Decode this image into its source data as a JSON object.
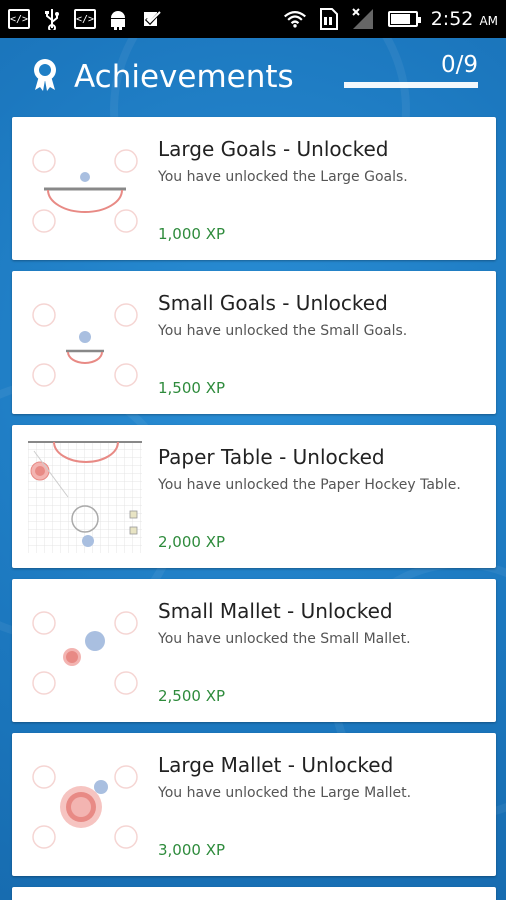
{
  "status_bar": {
    "time": "2:52",
    "ampm": "AM",
    "left_icons": [
      "code-icon",
      "usb-icon",
      "code-icon",
      "android-icon",
      "check-icon"
    ],
    "right_icons": [
      "wifi-icon",
      "sim-icon",
      "signal-icon",
      "battery-icon"
    ]
  },
  "header": {
    "title": "Achievements",
    "icon": "ribbon-icon",
    "progress": "0/9",
    "progress_fraction": 0
  },
  "achievements": [
    {
      "title": "Large Goals - Unlocked",
      "description": "You have unlocked the Large Goals.",
      "xp": "1,000 XP",
      "thumb": "large-goals"
    },
    {
      "title": "Small Goals - Unlocked",
      "description": "You have unlocked the Small Goals.",
      "xp": "1,500 XP",
      "thumb": "small-goals"
    },
    {
      "title": "Paper Table - Unlocked",
      "description": "You have unlocked the Paper Hockey Table.",
      "xp": "2,000 XP",
      "thumb": "paper-table"
    },
    {
      "title": "Small Mallet - Unlocked",
      "description": "You have unlocked the Small Mallet.",
      "xp": "2,500 XP",
      "thumb": "small-mallet"
    },
    {
      "title": "Large Mallet - Unlocked",
      "description": "You have unlocked the Large Mallet.",
      "xp": "3,000 XP",
      "thumb": "large-mallet"
    }
  ],
  "colors": {
    "accent": "#1f7fc6",
    "xp": "#2e8b3c",
    "goal": "#e88a85",
    "puck": "#a9bfe0"
  }
}
